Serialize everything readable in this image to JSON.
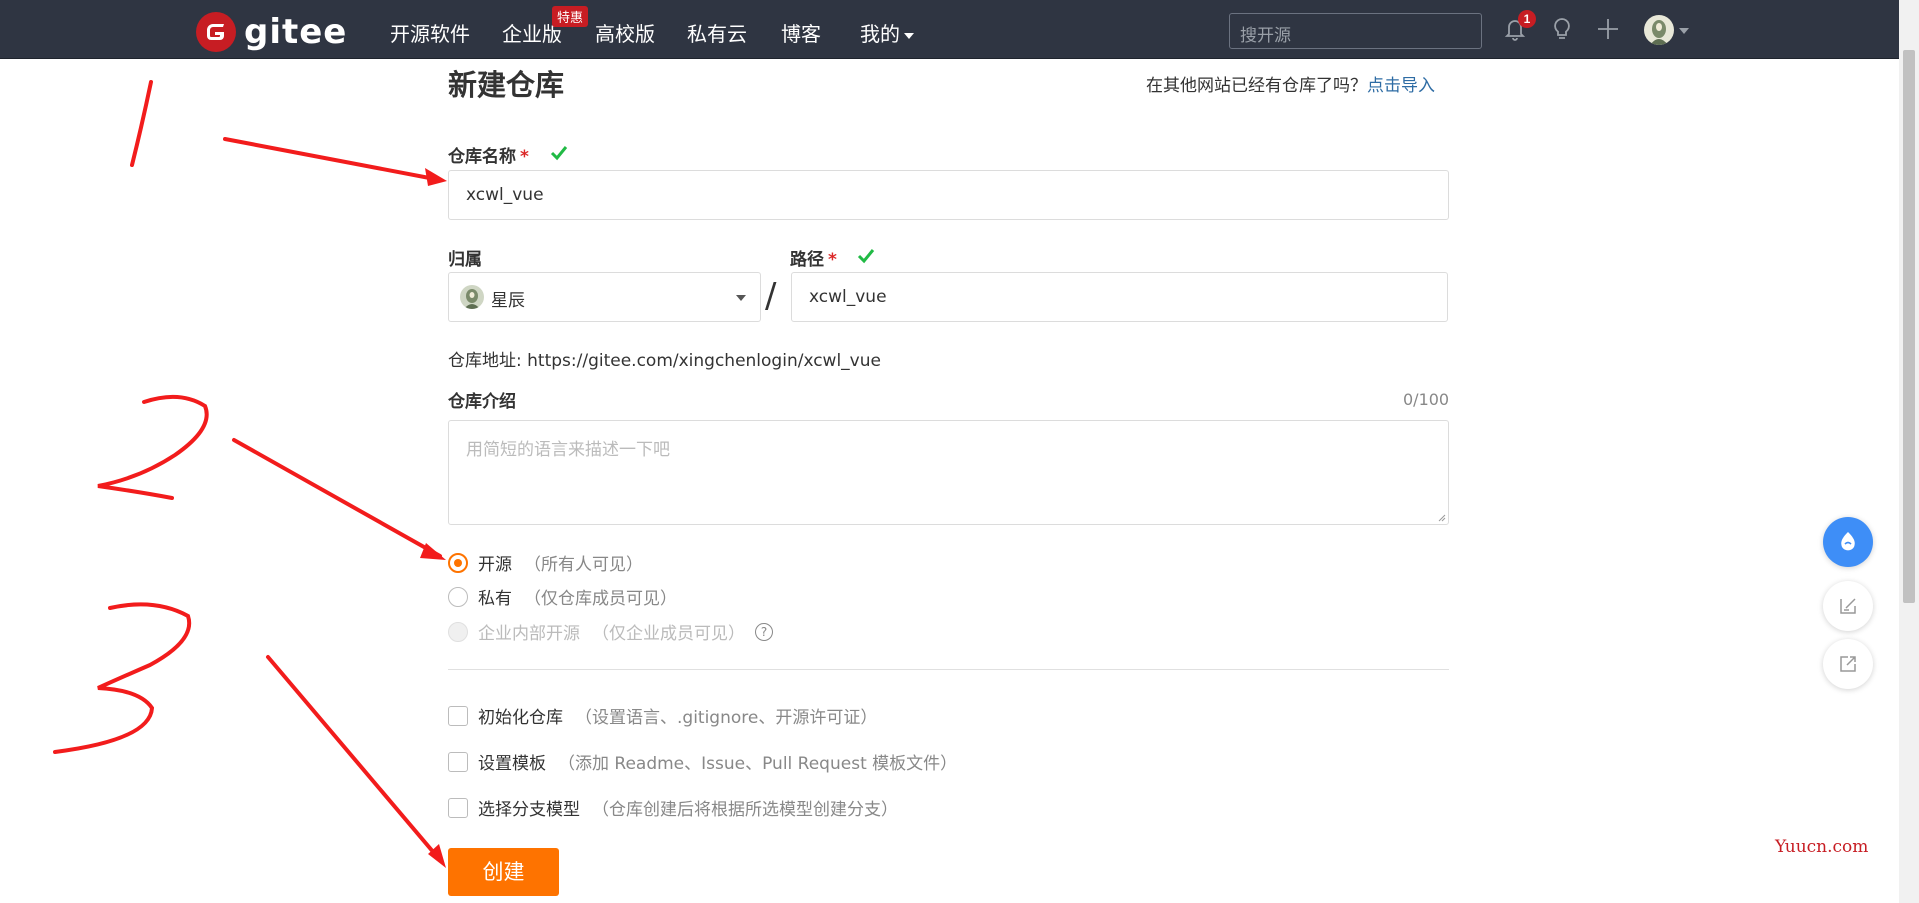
{
  "colors": {
    "nav_bg": "#2f3542",
    "brand_red": "#c71d23",
    "accent_orange": "#fe7300",
    "link_blue": "#2e6ca4",
    "check_green": "#21ba45"
  },
  "nav": {
    "logo_text": "gitee",
    "items": [
      "开源软件",
      "企业版",
      "高校版",
      "私有云",
      "博客",
      "我的"
    ],
    "enterprise_badge": "特惠",
    "search_placeholder": "搜开源",
    "notification_count": "1",
    "icons": [
      "bell-icon",
      "lightbulb-icon",
      "plus-icon",
      "avatar"
    ]
  },
  "form": {
    "title": "新建仓库",
    "import_hint": "在其他网站已经有仓库了吗？",
    "import_link": "点击导入",
    "repo_name_label": "仓库名称",
    "required_mark": "*",
    "repo_name_value": "xcwl_vue",
    "owner_label": "归属",
    "owner_value": "星辰",
    "separator": "/",
    "path_label": "路径",
    "path_value": "xcwl_vue",
    "address_text": "仓库地址: https://gitee.com/xingchenlogin/xcwl_vue",
    "desc_label": "仓库介绍",
    "desc_counter": "0/100",
    "desc_placeholder": "用简短的语言来描述一下吧",
    "visibility": [
      {
        "label": "开源",
        "hint": "（所有人可见）",
        "selected": true,
        "disabled": false
      },
      {
        "label": "私有",
        "hint": "（仅仓库成员可见）",
        "selected": false,
        "disabled": false
      },
      {
        "label": "企业内部开源",
        "hint": "（仅企业成员可见）",
        "selected": false,
        "disabled": true
      }
    ],
    "help_glyph": "?",
    "options": [
      {
        "label": "初始化仓库",
        "hint": "（设置语言、.gitignore、开源许可证）",
        "checked": false
      },
      {
        "label": "设置模板",
        "hint": "（添加 Readme、Issue、Pull Request 模板文件）",
        "checked": false
      },
      {
        "label": "选择分支模型",
        "hint": "（仓库创建后将根据所选模型创建分支）",
        "checked": false
      }
    ],
    "create_button": "创建"
  },
  "side_buttons": [
    "assistant-icon",
    "feedback-icon",
    "share-icon"
  ],
  "annotations": {
    "numbers": [
      "1",
      "2",
      "3"
    ],
    "ink_color": "#f21c1c"
  },
  "watermark": "Yuucn.com"
}
